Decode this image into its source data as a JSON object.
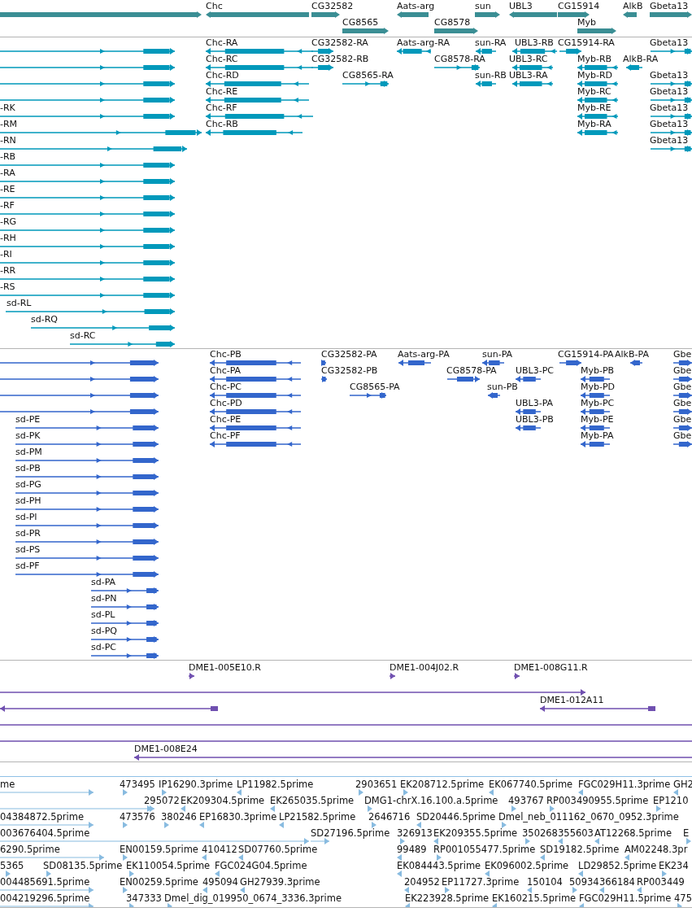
{
  "tracks": [
    {
      "kind": "gene",
      "rows": [
        {
          "features": [
            {
              "forward": true
            },
            {
              "label": "Chc",
              "forward": false
            },
            {
              "label": "CG32582",
              "forward": true
            },
            {
              "label": "Aats-arg",
              "forward": false
            },
            {
              "label": "sun",
              "forward": true
            },
            {
              "label": "UBL3",
              "forward": false
            },
            {
              "label": "CG15914",
              "forward": true
            },
            {
              "label": "AlkB",
              "forward": false
            },
            {
              "label": "Gbeta13",
              "forward": true
            }
          ]
        },
        {
          "features": [
            {
              "label": "CG8565",
              "forward": true
            },
            {
              "label": "CG8578",
              "forward": true
            },
            {
              "label": "Myb",
              "forward": true
            }
          ]
        }
      ]
    },
    {
      "kind": "transcript",
      "rows": [
        {
          "features": [
            {
              "forward": true
            },
            {
              "label": "Chc-RA",
              "forward": false
            },
            {
              "label": "CG32582-RA",
              "forward": true
            },
            {
              "label": "Aats-arg-RA",
              "forward": false
            },
            {
              "label": "sun-RA",
              "forward": false
            },
            {
              "label": "UBL3-RB",
              "forward": false
            },
            {
              "label": "CG15914-RA",
              "forward": true
            },
            {
              "label": "Gbeta13",
              "forward": true
            }
          ]
        },
        {
          "features": [
            {
              "forward": true
            },
            {
              "label": "Chc-RC",
              "forward": false
            },
            {
              "label": "CG32582-RB",
              "forward": true
            },
            {
              "label": "CG8578-RA",
              "forward": true
            },
            {
              "label": "UBL3-RC",
              "forward": false
            },
            {
              "label": "Myb-RB",
              "forward": false
            },
            {
              "label": "AlkB-RA",
              "forward": false
            }
          ]
        },
        {
          "features": [
            {
              "forward": true
            },
            {
              "label": "Chc-RD",
              "forward": false
            },
            {
              "label": "CG8565-RA",
              "forward": true
            },
            {
              "label": "sun-RB",
              "forward": false
            },
            {
              "label": "UBL3-RA",
              "forward": false
            },
            {
              "label": "Myb-RD",
              "forward": false
            },
            {
              "label": "Gbeta13",
              "forward": true
            }
          ]
        },
        {
          "features": [
            {
              "forward": true
            },
            {
              "label": "Chc-RE",
              "forward": false
            },
            {
              "label": "Myb-RC",
              "forward": false
            },
            {
              "label": "Gbeta13",
              "forward": true
            }
          ]
        },
        {
          "features": [
            {
              "label": "-RK",
              "forward": true
            },
            {
              "label": "Chc-RF",
              "forward": false
            },
            {
              "label": "Myb-RE",
              "forward": false
            },
            {
              "label": "Gbeta13",
              "forward": true
            }
          ]
        },
        {
          "features": [
            {
              "label": "-RM",
              "forward": true
            },
            {
              "label": "Chc-RB",
              "forward": false
            },
            {
              "label": "Myb-RA",
              "forward": false
            },
            {
              "label": "Gbeta13",
              "forward": true
            }
          ]
        },
        {
          "features": [
            {
              "label": "-RN",
              "forward": true
            },
            {
              "label": "Gbeta13",
              "forward": true
            }
          ]
        },
        {
          "features": [
            {
              "label": "-RB",
              "forward": true
            }
          ]
        },
        {
          "features": [
            {
              "label": "-RA",
              "forward": true
            }
          ]
        },
        {
          "features": [
            {
              "label": "-RE",
              "forward": true
            }
          ]
        },
        {
          "features": [
            {
              "label": "-RF",
              "forward": true
            }
          ]
        },
        {
          "features": [
            {
              "label": "-RG",
              "forward": true
            }
          ]
        },
        {
          "features": [
            {
              "label": "-RH",
              "forward": true
            }
          ]
        },
        {
          "features": [
            {
              "label": "-RI",
              "forward": true
            }
          ]
        },
        {
          "features": [
            {
              "label": "-RR",
              "forward": true
            }
          ]
        },
        {
          "features": [
            {
              "label": "-RS",
              "forward": true
            }
          ]
        },
        {
          "features": [
            {
              "label": "sd-RL",
              "forward": true
            }
          ]
        },
        {
          "features": [
            {
              "label": "sd-RQ",
              "forward": true
            }
          ]
        },
        {
          "features": [
            {
              "label": "sd-RC",
              "forward": true
            }
          ]
        }
      ]
    },
    {
      "kind": "protein",
      "rows": [
        {
          "features": [
            {
              "forward": true
            },
            {
              "label": "Chc-PB",
              "forward": false
            },
            {
              "label": "CG32582-PA",
              "forward": true
            },
            {
              "label": "Aats-arg-PA",
              "forward": false
            },
            {
              "label": "sun-PA",
              "forward": false
            },
            {
              "label": "CG15914-PA",
              "forward": true
            },
            {
              "label": "AlkB-PA",
              "forward": false
            },
            {
              "label": "Gbe",
              "forward": true
            }
          ]
        },
        {
          "features": [
            {
              "forward": true
            },
            {
              "label": "Chc-PA",
              "forward": false
            },
            {
              "label": "CG32582-PB",
              "forward": true
            },
            {
              "label": "CG8578-PA",
              "forward": true
            },
            {
              "label": "UBL3-PC",
              "forward": false
            },
            {
              "label": "Myb-PB",
              "forward": false
            },
            {
              "label": "Gbe",
              "forward": true
            }
          ]
        },
        {
          "features": [
            {
              "forward": true
            },
            {
              "label": "Chc-PC",
              "forward": false
            },
            {
              "label": "CG8565-PA",
              "forward": true
            },
            {
              "label": "sun-PB",
              "forward": false
            },
            {
              "label": "Myb-PD",
              "forward": false
            },
            {
              "label": "Gbe",
              "forward": true
            }
          ]
        },
        {
          "features": [
            {
              "forward": true
            },
            {
              "label": "Chc-PD",
              "forward": false
            },
            {
              "label": "UBL3-PA",
              "forward": false
            },
            {
              "label": "Myb-PC",
              "forward": false
            },
            {
              "label": "Gbe",
              "forward": true
            }
          ]
        },
        {
          "features": [
            {
              "label": "sd-PE",
              "forward": true
            },
            {
              "label": "Chc-PE",
              "forward": false
            },
            {
              "label": "UBL3-PB",
              "forward": false
            },
            {
              "label": "Myb-PE",
              "forward": false
            },
            {
              "label": "Gbe",
              "forward": true
            }
          ]
        },
        {
          "features": [
            {
              "label": "sd-PK",
              "forward": true
            },
            {
              "label": "Chc-PF",
              "forward": false
            },
            {
              "label": "Myb-PA",
              "forward": false
            },
            {
              "label": "Gbe",
              "forward": true
            }
          ]
        },
        {
          "features": [
            {
              "label": "sd-PM",
              "forward": true
            }
          ]
        },
        {
          "features": [
            {
              "label": "sd-PB",
              "forward": true
            }
          ]
        },
        {
          "features": [
            {
              "label": "sd-PG",
              "forward": true
            }
          ]
        },
        {
          "features": [
            {
              "label": "sd-PH",
              "forward": true
            }
          ]
        },
        {
          "features": [
            {
              "label": "sd-PI",
              "forward": true
            }
          ]
        },
        {
          "features": [
            {
              "label": "sd-PR",
              "forward": true
            }
          ]
        },
        {
          "features": [
            {
              "label": "sd-PS",
              "forward": true
            }
          ]
        },
        {
          "features": [
            {
              "label": "sd-PF",
              "forward": true
            }
          ]
        },
        {
          "features": [
            {
              "label": "sd-PA",
              "forward": true
            }
          ]
        },
        {
          "features": [
            {
              "label": "sd-PN",
              "forward": true
            }
          ]
        },
        {
          "features": [
            {
              "label": "sd-PL",
              "forward": true
            }
          ]
        },
        {
          "features": [
            {
              "label": "sd-PQ",
              "forward": true
            }
          ]
        },
        {
          "features": [
            {
              "label": "sd-PC",
              "forward": true
            }
          ]
        }
      ]
    },
    {
      "kind": "clone",
      "rows": [
        {
          "features": [
            {
              "label": "DME1-005E10.R",
              "forward": true
            },
            {
              "label": "DME1-004J02.R",
              "forward": true
            },
            {
              "label": "DME1-008G11.R",
              "forward": true
            }
          ]
        },
        {
          "features": [
            {
              "forward": true
            }
          ]
        },
        {
          "features": [
            {
              "forward": false
            },
            {
              "label": "DME1-012A11",
              "forward": false
            }
          ]
        },
        {
          "features": [
            {
              "forward": true
            }
          ]
        },
        {
          "features": [
            {
              "forward": true
            }
          ]
        },
        {
          "features": [
            {
              "label": "DME1-008E24",
              "forward": false
            }
          ]
        }
      ]
    },
    {
      "kind": "est",
      "rows": [
        {
          "features": [
            {
              "label": "me",
              "forward": true
            },
            {
              "label": "473495",
              "forward": true
            },
            {
              "label": "IP16290.3prime",
              "forward": true
            },
            {
              "label": "LP11982.5prime",
              "forward": false
            },
            {
              "label": "2903651",
              "forward": true
            },
            {
              "label": "EK208712.5prime",
              "forward": true
            },
            {
              "label": "EK067740.5prime",
              "forward": false
            },
            {
              "label": "FGC029H11.3prime",
              "forward": false
            },
            {
              "label": "GH2",
              "forward": false
            }
          ]
        },
        {
          "features": [
            {
              "forward": true
            },
            {
              "label": "295072",
              "forward": true
            },
            {
              "label": "EK209304.5prime",
              "forward": false
            },
            {
              "label": "EK265035.5prime",
              "forward": false
            },
            {
              "label": "DMG1-chrX.16.100.a.5prime",
              "forward": true
            },
            {
              "label": "493767",
              "forward": true
            },
            {
              "label": "RP003490955.5prime",
              "forward": true
            },
            {
              "label": "EP1210",
              "forward": true
            }
          ]
        },
        {
          "features": [
            {
              "label": "04384872.5prime",
              "forward": true
            },
            {
              "label": "473576",
              "forward": true
            },
            {
              "label": "380246",
              "forward": true
            },
            {
              "label": "EP16830.3prime",
              "forward": false
            },
            {
              "label": "LP21582.5prime",
              "forward": false
            },
            {
              "label": "2646716",
              "forward": true
            },
            {
              "label": "SD20446.5prime",
              "forward": false
            },
            {
              "label": "Dmel_neb_011162_0670_0952.3prime",
              "forward": true
            }
          ]
        },
        {
          "features": [
            {
              "label": "003676404.5prime",
              "forward": true
            },
            {
              "label": "SD27196.5prime",
              "forward": true
            },
            {
              "label": "326913",
              "forward": true
            },
            {
              "label": "EK209355.5prime",
              "forward": false
            },
            {
              "label": "350268",
              "forward": true
            },
            {
              "label": "355603",
              "forward": false
            },
            {
              "label": "AT12268.5prime",
              "forward": false
            },
            {
              "label": "E",
              "forward": true
            }
          ]
        },
        {
          "features": [
            {
              "label": "6290.5prime",
              "forward": true
            },
            {
              "label": "EN00159.5prime",
              "forward": true
            },
            {
              "label": "410412",
              "forward": false
            },
            {
              "label": "SD07760.5prime",
              "forward": false
            },
            {
              "label": "99489",
              "forward": false
            },
            {
              "label": "RP001055477.5prime",
              "forward": true
            },
            {
              "label": "SD19182.5prime",
              "forward": false
            },
            {
              "label": "AM02248.3pr",
              "forward": false
            }
          ]
        },
        {
          "features": [
            {
              "label": "5365",
              "forward": true
            },
            {
              "label": "SD08135.5prime",
              "forward": true
            },
            {
              "label": "EK110054.5prime",
              "forward": true
            },
            {
              "label": "FGC024G04.5prime",
              "forward": false
            },
            {
              "label": "EK084443.5prime",
              "forward": false
            },
            {
              "label": "EK096002.5prime",
              "forward": false
            },
            {
              "label": "LD29852.5prime",
              "forward": false
            },
            {
              "label": "EK234",
              "forward": true
            }
          ]
        },
        {
          "features": [
            {
              "label": "004485691.5prime",
              "forward": true
            },
            {
              "label": "EN00259.5prime",
              "forward": true
            },
            {
              "label": "495094",
              "forward": false
            },
            {
              "label": "GH27939.3prime",
              "forward": false
            },
            {
              "label": "204952",
              "forward": false
            },
            {
              "label": "EP11727.3prime",
              "forward": true
            },
            {
              "label": "150104",
              "forward": false
            },
            {
              "label": "50934",
              "forward": true
            },
            {
              "label": "366184",
              "forward": false
            },
            {
              "label": "RP003449",
              "forward": false
            }
          ]
        },
        {
          "features": [
            {
              "label": "004219296.5prime",
              "forward": true
            },
            {
              "label": "347333",
              "forward": true
            },
            {
              "label": "Dmel_dig_019950_0674_3336.3prime",
              "forward": true
            },
            {
              "label": "EK223928.5prime",
              "forward": false
            },
            {
              "label": "EK160215.5prime",
              "forward": false
            },
            {
              "label": "FGC029H11.5prime",
              "forward": false
            },
            {
              "label": "475",
              "forward": true
            }
          ]
        }
      ]
    }
  ]
}
